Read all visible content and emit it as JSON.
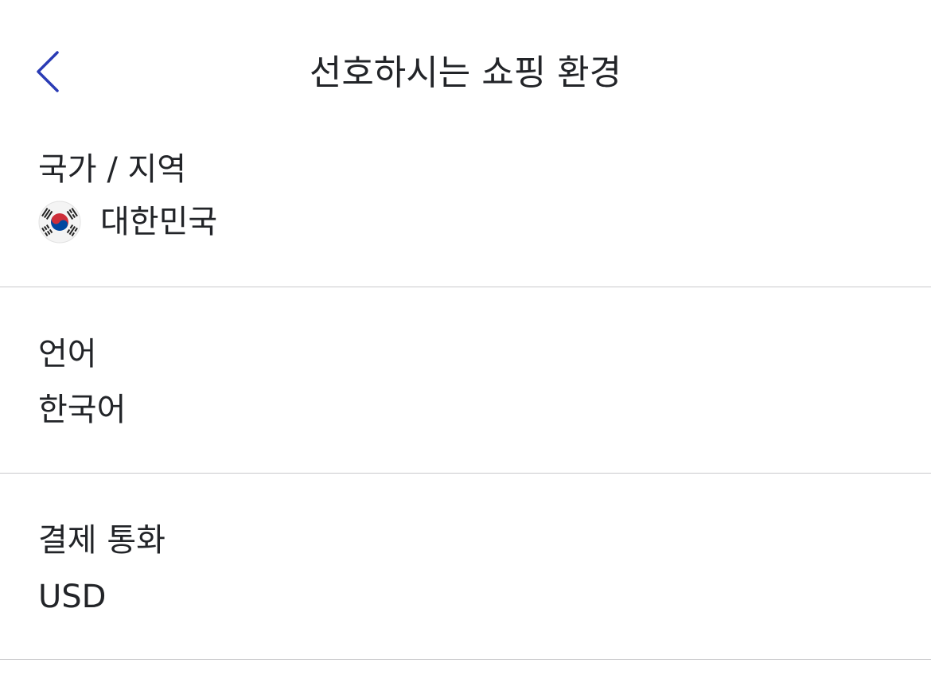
{
  "header": {
    "back_icon": "chevron-left-icon",
    "title": "선호하시는 쇼핑 환경",
    "accent_color": "#2a3bb5"
  },
  "sections": [
    {
      "label": "국가 / 지역",
      "value": "대한민국",
      "icon": "south-korea-flag-icon"
    },
    {
      "label": "언어",
      "value": "한국어"
    },
    {
      "label": "결제 통화",
      "value": "USD"
    }
  ]
}
